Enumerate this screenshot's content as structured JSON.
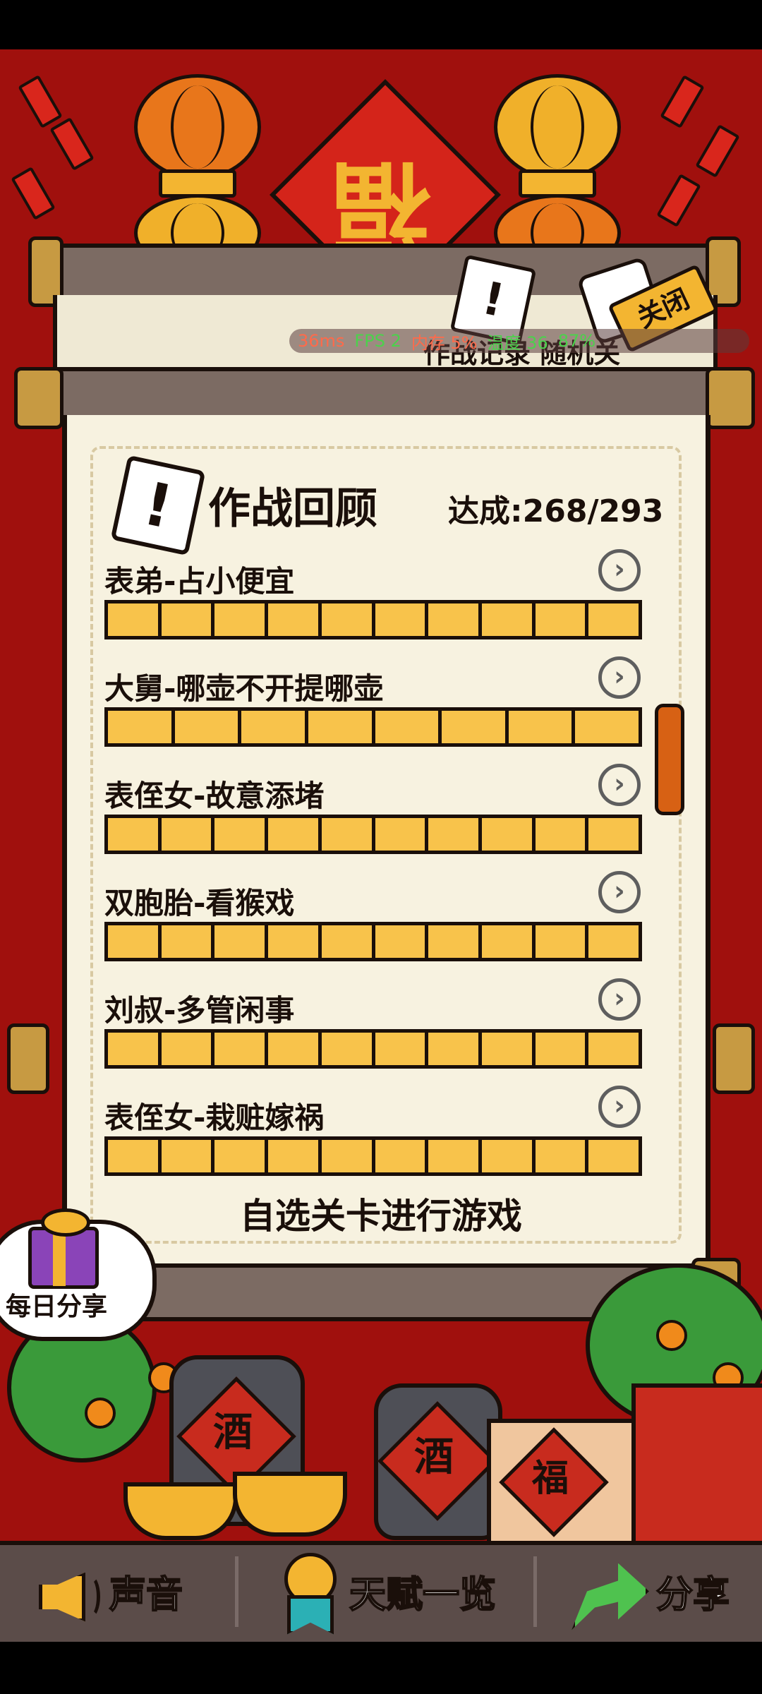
{
  "top_scroll": {
    "tab_text": "作战记录  随机关",
    "close_label": "关闭"
  },
  "perf_overlay": {
    "items": [
      "36ms",
      "FPS 2",
      "内存 5%",
      "温度 36",
      "87%"
    ]
  },
  "panel": {
    "title": "作战回顾",
    "progress": "达成:268/293",
    "levels": [
      {
        "name": "表弟-占小便宜",
        "segments": 10
      },
      {
        "name": "大舅-哪壶不开提哪壶",
        "segments": 8
      },
      {
        "name": "表侄女-故意添堵",
        "segments": 10
      },
      {
        "name": "双胞胎-看猴戏",
        "segments": 10
      },
      {
        "name": "刘叔-多管闲事",
        "segments": 10
      },
      {
        "name": "表侄女-栽赃嫁祸",
        "segments": 10
      }
    ],
    "select_label": "自选关卡进行游戏"
  },
  "daily_share": {
    "label": "每日分享"
  },
  "decor": {
    "fu": "福",
    "jiu": "酒"
  },
  "bottom_nav": {
    "sound": "声音",
    "talents": "天赋一览",
    "share": "分享"
  },
  "colors": {
    "background_red": "#a0100d",
    "bar_yellow": "#f8c34b",
    "paper": "#f7f2e0",
    "nav_bg": "#5b4c49",
    "scrollbar_orange": "#d76114"
  },
  "icons": [
    "alert-card-icon",
    "dice-icon",
    "gift-icon",
    "speaker-icon",
    "medal-icon",
    "share-arrow-icon",
    "chevron-right-icon"
  ]
}
